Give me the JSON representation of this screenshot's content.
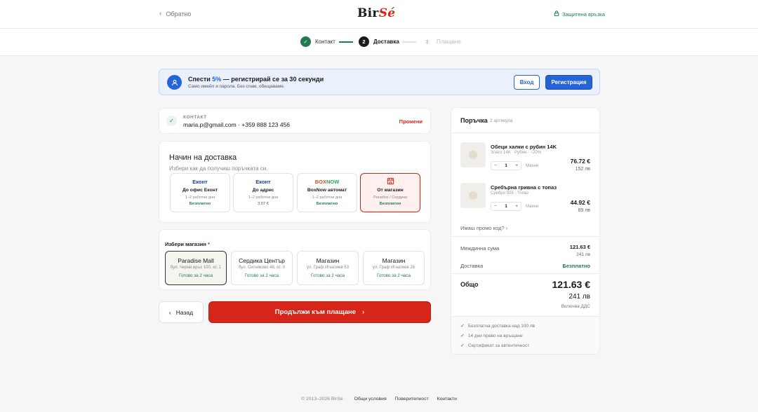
{
  "header": {
    "back_label": "Обратно",
    "logo_main": "Bir",
    "logo_accent": "Sé",
    "secure_label": "Защитена връзка"
  },
  "stepper": {
    "steps": [
      {
        "number": "1",
        "label": "Контакт",
        "state": "done"
      },
      {
        "number": "2",
        "label": "Доставка",
        "state": "active"
      },
      {
        "number": "3",
        "label": "Плащане",
        "state": "todo"
      }
    ]
  },
  "promo": {
    "title_pre": "Спести ",
    "title_pct": "5%",
    "title_post": " — регистрирай се за 30 секунди",
    "subtitle": "Само имейл и парола. Без спам, обещаваме.",
    "login_label": "Вход",
    "register_label": "Регистрация"
  },
  "contact": {
    "label": "КОНТАКТ",
    "value": "maria.p@gmail.com · +359 888 123 456",
    "edit_label": "Промени"
  },
  "delivery": {
    "heading": "Начин на доставка",
    "subheading": "Избери как да получиш поръчката си.",
    "options": [
      {
        "brand": "Еконт",
        "name": "До офис Еконт",
        "days": "1–2 работни дни",
        "price": "Безплатно"
      },
      {
        "brand": "Еконт",
        "name": "До адрес",
        "days": "1–2 работни дни",
        "price": "3.07 €"
      },
      {
        "brand_a": "BOX",
        "brand_b": "NOW",
        "name": "BoxNow автомат",
        "days": "1–2 работни дни",
        "price": "Безплатно"
      },
      {
        "brand": "store-icon",
        "name": "От магазин",
        "days": "Paradise / Сердика",
        "price": "Безплатно"
      }
    ]
  },
  "stores": {
    "label": "Избери магазин",
    "required_mark": "*",
    "items": [
      {
        "name": "Paradise Mall",
        "address": "бул. Черни връх 100, ет. 1",
        "ready": "Готово за 2 часа"
      },
      {
        "name": "Сердика Център",
        "address": "бул. Ситняково 48, ет. 0",
        "ready": "Готово за 2 часа"
      },
      {
        "name": "Магазин",
        "address": "ул. Граф Игнатиев 53",
        "ready": "Готово за 2 часа"
      },
      {
        "name": "Магазин",
        "address": "ул. Граф Игнатиев 26",
        "ready": "Готово за 2 часа"
      }
    ]
  },
  "actions": {
    "back_label": "Назад",
    "continue_label": "Продължи към плащане"
  },
  "summary": {
    "title": "Поръчка",
    "count": "2 артикула",
    "items": [
      {
        "name": "Обеци халки с рубин 14K",
        "meta": "Злато 14K · Рубин · −20%",
        "qty": "1",
        "remove": "Махни",
        "price": "76.72 €",
        "price_bgn": "152 лв"
      },
      {
        "name": "Сребърна гривна с топаз",
        "meta": "Сребро 925 · Топаз",
        "qty": "1",
        "remove": "Махни",
        "price": "44.92 €",
        "price_bgn": "89 лв"
      }
    ],
    "promo_link": "Имаш промо код?",
    "subtotal_label": "Междинна сума",
    "subtotal_value": "121.63 €",
    "subtotal_bgn": "241 лв",
    "shipping_label": "Доставка",
    "shipping_value": "Безплатно",
    "total_label": "Общо",
    "total_value": "121.63 €",
    "total_bgn": "241 лв",
    "vat_note": "Включва ДДС",
    "perks": [
      "Безплатна доставка над 100 лв",
      "14 дни право на връщане",
      "Сертификат за автентичност"
    ]
  },
  "footer": {
    "copyright": "© 2013–2026 BirSé ·",
    "links": [
      "Общи условия",
      "Поверителност",
      "Контакти"
    ]
  },
  "colors": {
    "accent_red": "#d6261a",
    "success_green": "#1f7a4e",
    "primary_blue": "#2563d9"
  }
}
